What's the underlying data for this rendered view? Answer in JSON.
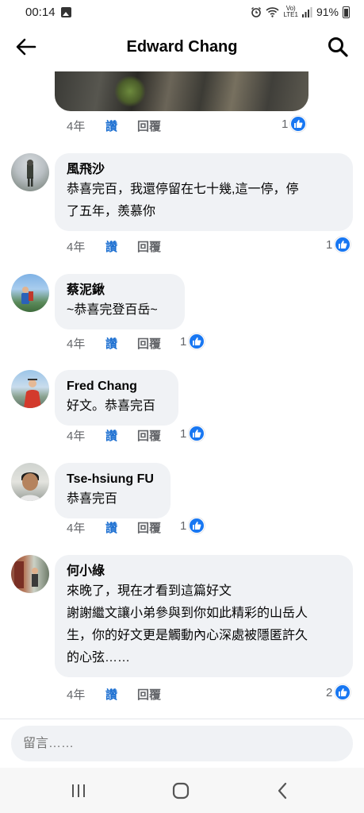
{
  "status": {
    "time": "00:14",
    "lte": "Vo)\nLTE1",
    "battery": "91%"
  },
  "header": {
    "title": "Edward Chang"
  },
  "top_comment": {
    "age": "4年",
    "like_label": "讚",
    "reply_label": "回覆",
    "reactions": "1"
  },
  "comments": [
    {
      "name": "風飛沙",
      "text": "恭喜完百，我還停留在七十幾,這一停，停\n了五年，羨慕你",
      "age": "4年",
      "like_label": "讚",
      "reply_label": "回覆",
      "reactions": "1"
    },
    {
      "name": "蔡泥鍬",
      "text": "~恭喜完登百岳~",
      "age": "4年",
      "like_label": "讚",
      "reply_label": "回覆",
      "reactions": "1"
    },
    {
      "name": "Fred Chang",
      "text": "好文。恭喜完百",
      "age": "4年",
      "like_label": "讚",
      "reply_label": "回覆",
      "reactions": "1"
    },
    {
      "name": "Tse-hsiung FU",
      "text": "恭喜完百",
      "age": "4年",
      "like_label": "讚",
      "reply_label": "回覆",
      "reactions": "1"
    },
    {
      "name": "何小綠",
      "text": "來晚了，現在才看到這篇好文\n謝謝繼文讓小弟參與到你如此精彩的山岳人\n生，你的好文更是觸動內心深處被隱匿許久\n的心弦……",
      "age": "4年",
      "like_label": "讚",
      "reply_label": "回覆",
      "reactions": "2"
    }
  ],
  "composer": {
    "placeholder": "留言……"
  },
  "colors": {
    "accent": "#1877f2",
    "like_text": "#1c6fd1",
    "bubble": "#f0f2f5",
    "secondary_text": "#65676b"
  }
}
